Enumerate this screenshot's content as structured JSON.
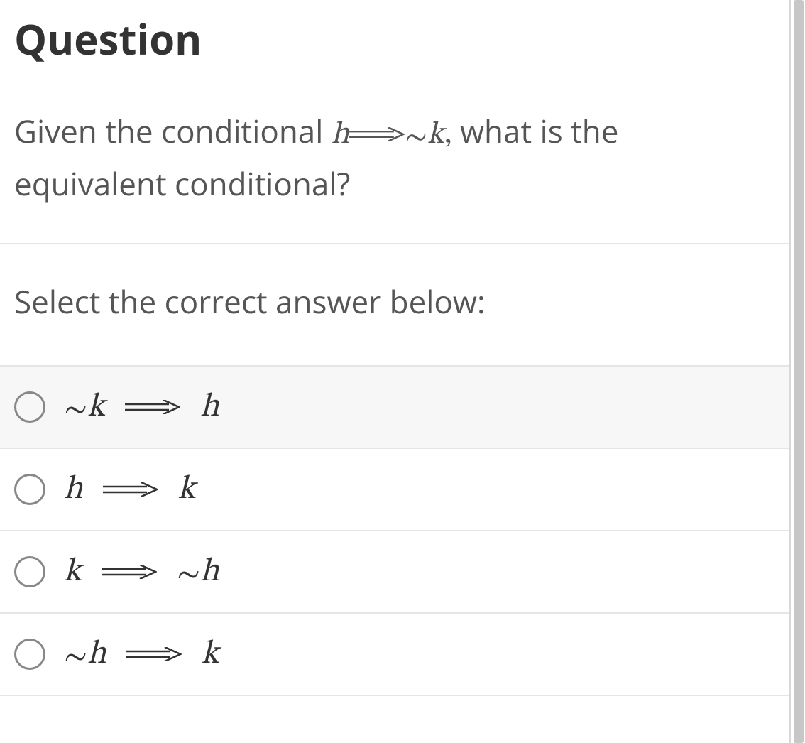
{
  "header": {
    "title": "Question"
  },
  "question": {
    "prefix": "Given the conditional ",
    "conditional_lhs": "h",
    "conditional_rhs_neg": "∼",
    "conditional_rhs": "k",
    "comma": ",",
    "suffix": " what is the equivalent conditional?"
  },
  "instruction": "Select the correct answer below:",
  "options": [
    {
      "lhs_neg": "∼",
      "lhs": "k",
      "rhs_neg": "",
      "rhs": "h",
      "highlighted": true
    },
    {
      "lhs_neg": "",
      "lhs": "h",
      "rhs_neg": "",
      "rhs": "k",
      "highlighted": false
    },
    {
      "lhs_neg": "",
      "lhs": "k",
      "rhs_neg": "∼",
      "rhs": "h",
      "highlighted": false
    },
    {
      "lhs_neg": "∼",
      "lhs": "h",
      "rhs_neg": "",
      "rhs": "k",
      "highlighted": false
    }
  ]
}
